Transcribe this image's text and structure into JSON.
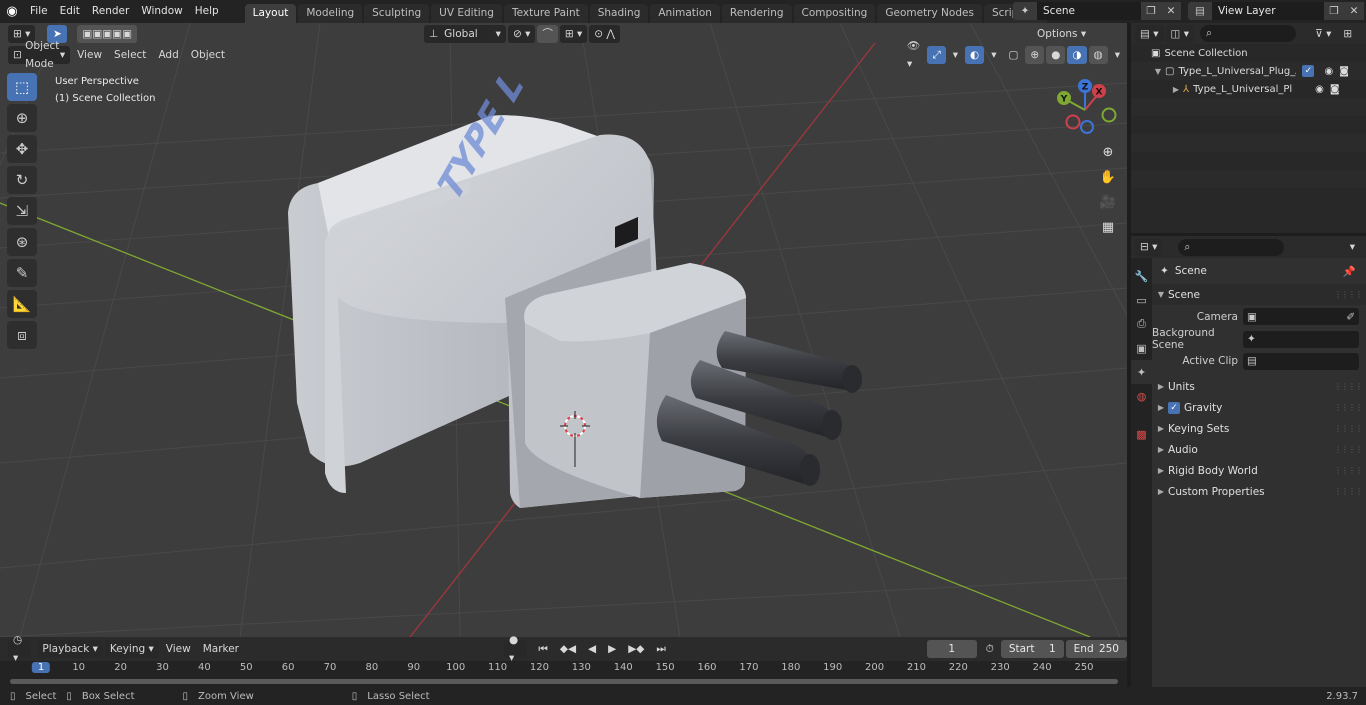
{
  "topbar": {
    "menus": [
      "File",
      "Edit",
      "Render",
      "Window",
      "Help"
    ],
    "workspaces": [
      "Layout",
      "Modeling",
      "Sculpting",
      "UV Editing",
      "Texture Paint",
      "Shading",
      "Animation",
      "Rendering",
      "Compositing",
      "Geometry Nodes",
      "Scripting"
    ],
    "active_workspace": "Layout",
    "add_label": "+",
    "scene_name": "Scene",
    "view_layer_name": "View Layer"
  },
  "viewport": {
    "mode": "Object Mode",
    "menus": [
      "View",
      "Select",
      "Add",
      "Object"
    ],
    "transform_orientation": "Global",
    "options_label": "Options",
    "view_name": "User Perspective",
    "collection_label": "(1) Scene Collection",
    "model_text": "TYPE L",
    "gizmo": {
      "x": "X",
      "y": "Y",
      "z": "Z"
    }
  },
  "timeline": {
    "menus": [
      "Playback",
      "Keying",
      "View",
      "Marker"
    ],
    "current_frame": "1",
    "start_label": "Start",
    "start_value": "1",
    "end_label": "End",
    "end_value": "250",
    "ruler_marks": [
      "1",
      "10",
      "20",
      "30",
      "40",
      "50",
      "60",
      "70",
      "80",
      "90",
      "100",
      "110",
      "120",
      "130",
      "140",
      "150",
      "160",
      "170",
      "180",
      "190",
      "200",
      "210",
      "220",
      "230",
      "240",
      "250"
    ]
  },
  "statusbar": {
    "select": "Select",
    "box_select": "Box Select",
    "zoom_view": "Zoom View",
    "lasso_select": "Lasso Select",
    "version": "2.93.7"
  },
  "outliner": {
    "root": "Scene Collection",
    "collection": "Type_L_Universal_Plug_Adap",
    "object": "Type_L_Universal_Plug_A"
  },
  "properties": {
    "context": "Scene",
    "panel_scene": "Scene",
    "camera_label": "Camera",
    "background_scene_label": "Background Scene",
    "active_clip_label": "Active Clip",
    "panels": [
      "Units",
      "Gravity",
      "Keying Sets",
      "Audio",
      "Rigid Body World",
      "Custom Properties"
    ]
  },
  "colors": {
    "accent": "#4772b3",
    "x_axis": "#a0363e",
    "y_axis": "#7fa832",
    "viewport_bg": "#3d3d3d"
  }
}
